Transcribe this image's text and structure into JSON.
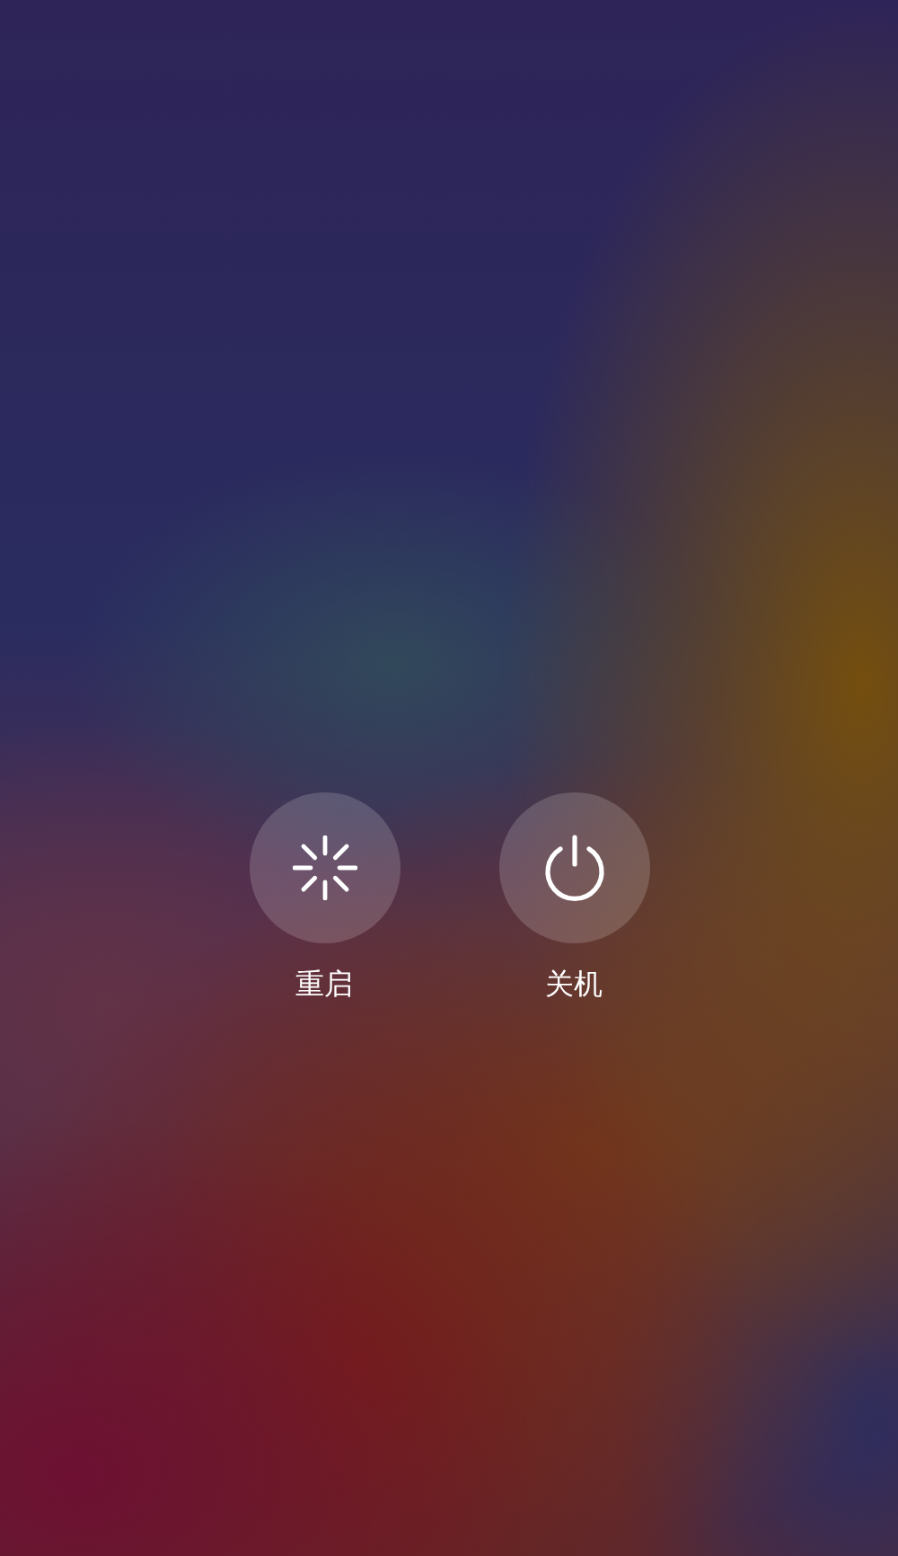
{
  "buttons": [
    {
      "kind": "restart",
      "label": "重启"
    },
    {
      "kind": "power",
      "label": "关机"
    }
  ]
}
